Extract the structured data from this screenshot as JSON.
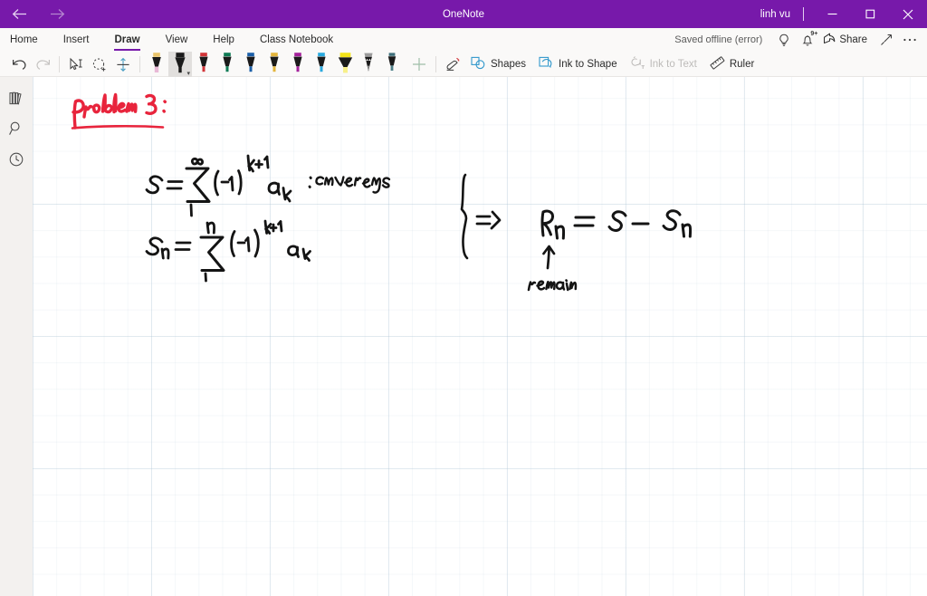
{
  "window": {
    "title": "OneNote",
    "user": "linh vu",
    "back_icon": "back-arrow-icon",
    "forward_icon": "forward-arrow-icon",
    "minimize_icon": "minimize-icon",
    "maximize_icon": "maximize-icon",
    "close_icon": "close-icon",
    "accent_color": "#7719AA"
  },
  "ribbon": {
    "tabs": [
      {
        "label": "Home",
        "active": false
      },
      {
        "label": "Insert",
        "active": false
      },
      {
        "label": "Draw",
        "active": true
      },
      {
        "label": "View",
        "active": false
      },
      {
        "label": "Help",
        "active": false
      },
      {
        "label": "Class Notebook",
        "active": false
      }
    ],
    "status": {
      "save_state": "Saved offline (error)",
      "tell_me_icon": "lightbulb-icon",
      "notifications_icon": "bell-icon",
      "notifications_badge": "9+",
      "share_label": "Share",
      "share_icon": "share-icon",
      "expand_icon": "expand-arrow-icon",
      "more_icon": "ellipsis-icon"
    }
  },
  "toolbar": {
    "undo_icon": "undo-icon",
    "redo_icon": "redo-icon",
    "select_icon": "select-text-icon",
    "lasso_icon": "lasso-select-icon",
    "insert_space_icon": "insert-space-icon",
    "add_pen_icon": "add-pen-icon",
    "eraser_icon": "eraser-icon",
    "pens": [
      {
        "name": "highlighter-pink",
        "cap": "#e8c36a",
        "barrel": "#1a1a1a",
        "tip": "#e8b9d6",
        "type": "highlighter",
        "selected": false
      },
      {
        "name": "pen-black",
        "cap": "#1a1a1a",
        "barrel": "#1a1a1a",
        "tip": "#1a1a1a",
        "type": "pen",
        "selected": true
      },
      {
        "name": "pen-red",
        "cap": "#d13438",
        "barrel": "#1a1a1a",
        "tip": "#d13438",
        "type": "pen",
        "selected": false
      },
      {
        "name": "pen-green",
        "cap": "#0f7b55",
        "barrel": "#1a1a1a",
        "tip": "#0f7b55",
        "type": "pen",
        "selected": false
      },
      {
        "name": "pen-blue",
        "cap": "#1b5fa8",
        "barrel": "#1a1a1a",
        "tip": "#1b5fa8",
        "type": "pen",
        "selected": false
      },
      {
        "name": "pen-gold",
        "cap": "#e3b53c",
        "barrel": "#1a1a1a",
        "tip": "#e3b53c",
        "type": "pen",
        "selected": false
      },
      {
        "name": "pen-magenta",
        "cap": "#a4219b",
        "barrel": "#1a1a1a",
        "tip": "#a4219b",
        "type": "pen",
        "selected": false
      },
      {
        "name": "pen-cyan",
        "cap": "#29a9de",
        "barrel": "#1a1a1a",
        "tip": "#29a9de",
        "type": "pen",
        "selected": false
      },
      {
        "name": "highlighter-yellow",
        "cap": "#f2e31a",
        "barrel": "#1a1a1a",
        "tip": "#f7ef8a",
        "type": "highlighter",
        "selected": false
      },
      {
        "name": "pencil-gray",
        "cap": "#9b9b9b",
        "barrel": "#1a1a1a",
        "tip": "#9b9b9b",
        "type": "pencil",
        "selected": false
      },
      {
        "name": "pen-teal",
        "cap": "#3e6f7a",
        "barrel": "#1a1a1a",
        "tip": "#3e6f7a",
        "type": "pen",
        "selected": false
      }
    ],
    "tools": [
      {
        "label": "Shapes",
        "icon": "shapes-icon",
        "enabled": true
      },
      {
        "label": "Ink to Shape",
        "icon": "ink-to-shape-icon",
        "enabled": true
      },
      {
        "label": "Ink to Text",
        "icon": "ink-to-text-icon",
        "enabled": false
      },
      {
        "label": "Ruler",
        "icon": "ruler-icon",
        "enabled": true
      }
    ]
  },
  "sidebar": {
    "items": [
      {
        "name": "notebooks",
        "icon": "notebooks-icon"
      },
      {
        "name": "search",
        "icon": "search-icon"
      },
      {
        "name": "recent",
        "icon": "clock-icon"
      }
    ]
  },
  "canvas": {
    "background": "grid-paper",
    "ink_notes": [
      {
        "id": "heading",
        "text": "Problem 3:",
        "color": "#e8243c",
        "underlined": true
      },
      {
        "id": "series-s",
        "text": "S = ∑(-1)^(k+1) a_k",
        "color": "#111111"
      },
      {
        "id": "converges-label",
        "text": ": converges",
        "color": "#111111"
      },
      {
        "id": "partial-sum",
        "text": "S_n = ∑(-1)^(k+1) a_k",
        "color": "#111111"
      },
      {
        "id": "implies",
        "text": "=>",
        "color": "#111111"
      },
      {
        "id": "remainder-eq",
        "text": "R_n = S - S_n",
        "color": "#111111"
      },
      {
        "id": "remainder-label",
        "text": "remain",
        "color": "#111111"
      }
    ]
  }
}
